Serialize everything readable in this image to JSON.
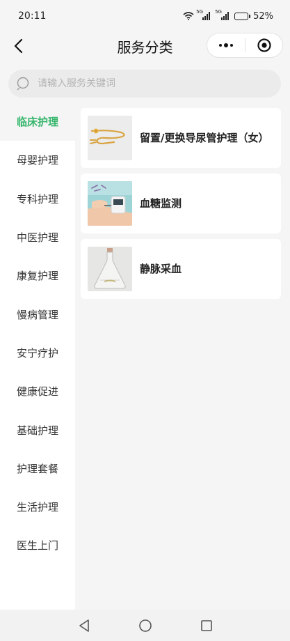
{
  "status_bar": {
    "time": "20:11",
    "signal_1_label": "5G",
    "signal_2_label": "5G",
    "battery": "52%",
    "battery_level": 0.52,
    "icons": [
      "wifi-icon",
      "signal-icon",
      "signal-icon",
      "battery-icon"
    ]
  },
  "nav": {
    "title": "服务分类",
    "back_icon": "chevron-left-icon",
    "more_icon": "more-dots-icon",
    "close_icon": "target-circle-icon"
  },
  "search": {
    "placeholder": "请输入服务关键词",
    "value": "",
    "icon": "search-icon"
  },
  "sidebar": {
    "active_index": 0,
    "active_color": "#35b66b",
    "items": [
      {
        "label": "临床护理"
      },
      {
        "label": "母婴护理"
      },
      {
        "label": "专科护理"
      },
      {
        "label": "中医护理"
      },
      {
        "label": "康复护理"
      },
      {
        "label": "慢病管理"
      },
      {
        "label": "安宁疗护"
      },
      {
        "label": "健康促进"
      },
      {
        "label": "基础护理"
      },
      {
        "label": "护理套餐"
      },
      {
        "label": "生活护理"
      },
      {
        "label": "医生上门"
      }
    ]
  },
  "services": [
    {
      "name": "留置/更换导尿管护理（女）",
      "image": "catheter-image"
    },
    {
      "name": "血糖监测",
      "image": "glucose-meter-image"
    },
    {
      "name": "静脉采血",
      "image": "flask-image"
    }
  ],
  "bottom_nav": {
    "icons": [
      "back-triangle-icon",
      "home-circle-icon",
      "recents-square-icon"
    ]
  }
}
